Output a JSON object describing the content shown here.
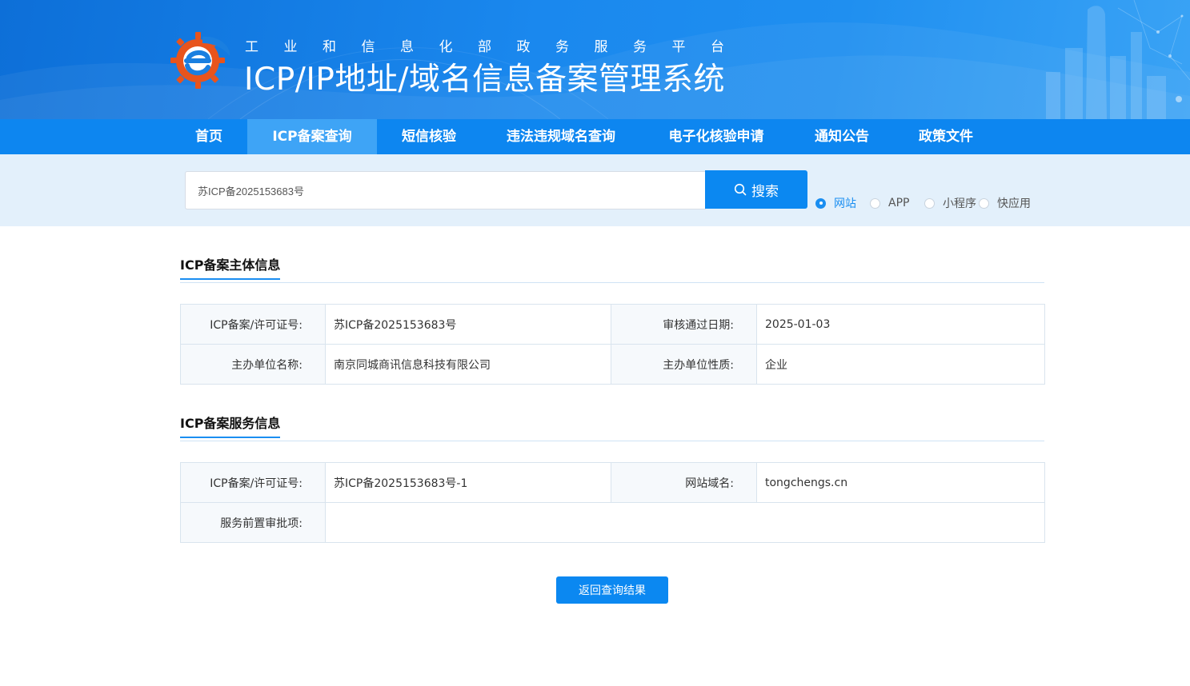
{
  "header": {
    "subtitle": "工业和信息化部政务服务平台",
    "title": "ICP/IP地址/域名信息备案管理系统"
  },
  "nav": {
    "items": [
      {
        "label": "首页",
        "active": false
      },
      {
        "label": "ICP备案查询",
        "active": true
      },
      {
        "label": "短信核验",
        "active": false
      },
      {
        "label": "违法违规域名查询",
        "active": false
      },
      {
        "label": "电子化核验申请",
        "active": false
      },
      {
        "label": "通知公告",
        "active": false
      },
      {
        "label": "政策文件",
        "active": false
      }
    ]
  },
  "search": {
    "value": "苏ICP备2025153683号",
    "button_label": "搜索",
    "options": [
      {
        "label": "网站",
        "checked": true
      },
      {
        "label": "APP",
        "checked": false
      },
      {
        "label": "小程序",
        "checked": false
      },
      {
        "label": "快应用",
        "checked": false
      }
    ]
  },
  "subject_info": {
    "title": "ICP备案主体信息",
    "rows": [
      [
        {
          "key": "ICP备案/许可证号:",
          "value": "苏ICP备2025153683号"
        },
        {
          "key": "审核通过日期:",
          "value": "2025-01-03"
        }
      ],
      [
        {
          "key": "主办单位名称:",
          "value": "南京同城商讯信息科技有限公司"
        },
        {
          "key": "主办单位性质:",
          "value": "企业"
        }
      ]
    ]
  },
  "service_info": {
    "title": "ICP备案服务信息",
    "license_key": "ICP备案/许可证号:",
    "license_value": "苏ICP备2025153683号-1",
    "domain_key": "网站域名:",
    "domain_value": "tongchengs.cn",
    "approval_key": "服务前置审批项:",
    "approval_value": ""
  },
  "back_button_label": "返回查询结果",
  "colors": {
    "primary": "#0b88f1",
    "nav_bg": "#0d86f0",
    "nav_active": "#3ea4f6",
    "search_bg": "#e3f0fb"
  }
}
